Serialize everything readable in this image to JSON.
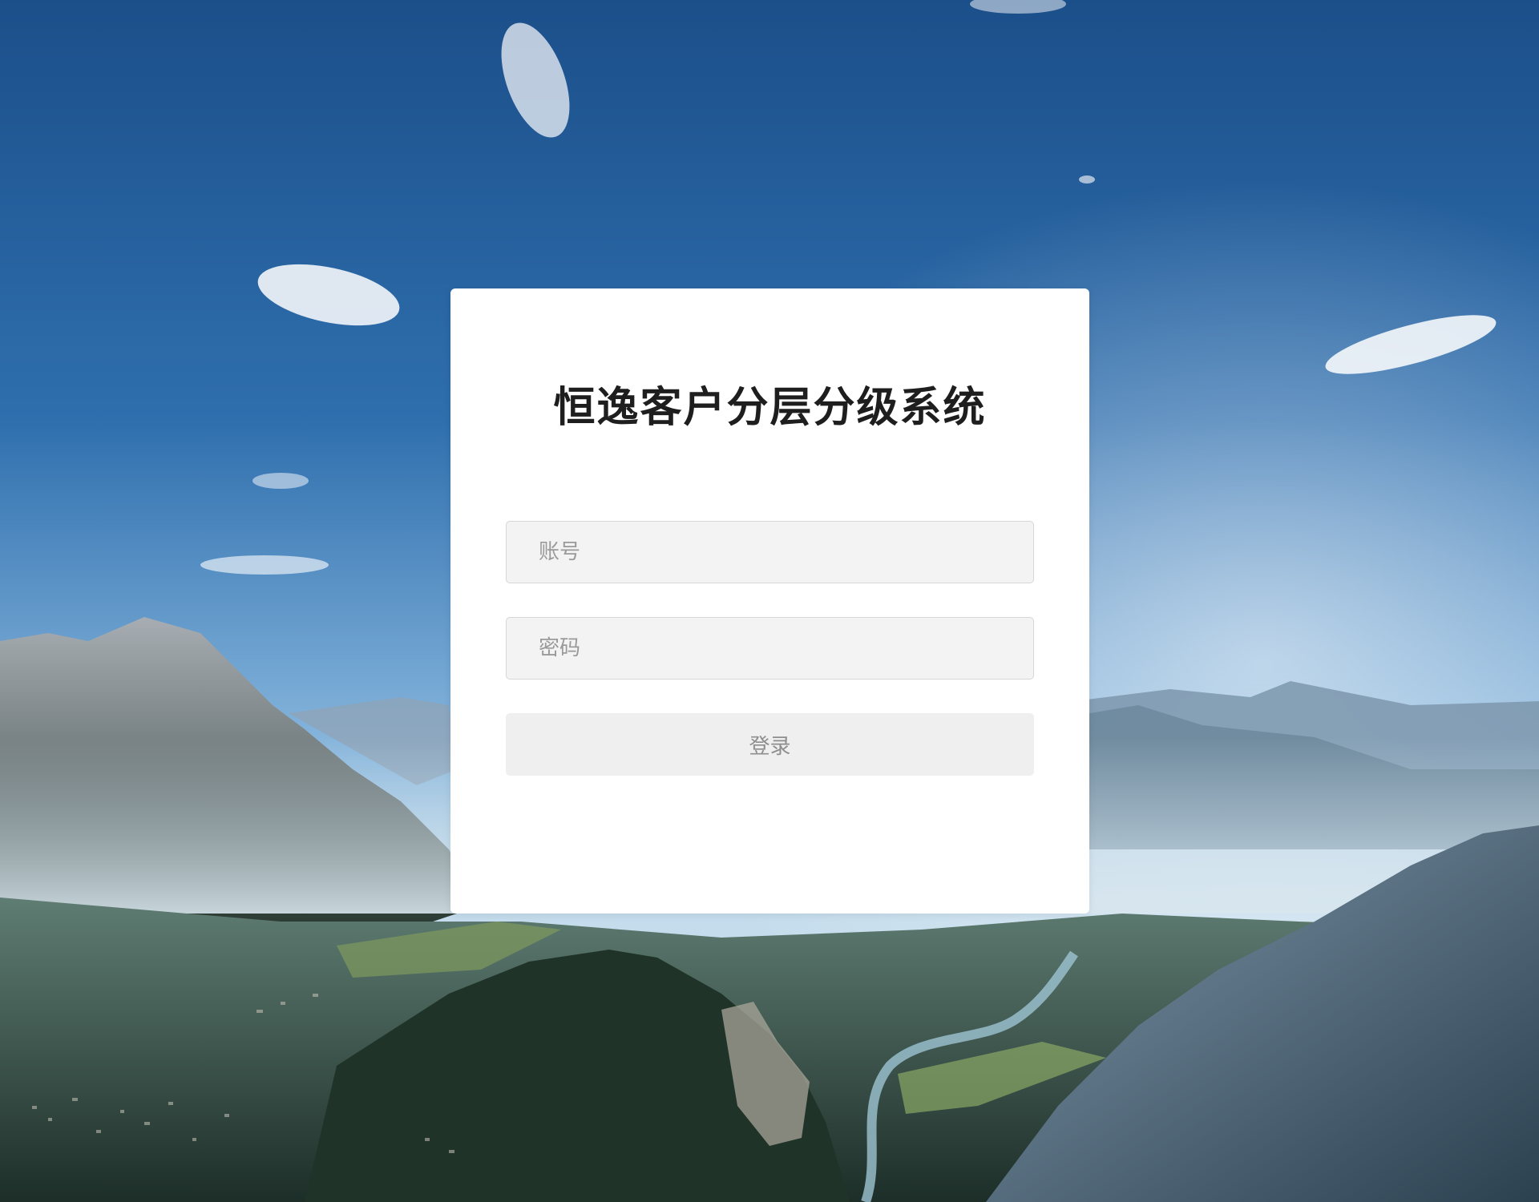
{
  "login": {
    "title": "恒逸客户分层分级系统",
    "account_placeholder": "账号",
    "account_value": "",
    "password_placeholder": "密码",
    "password_value": "",
    "submit_label": "登录"
  },
  "background": {
    "description_icon": "mountain-landscape-photo",
    "sky_top_color": "#1f5d9c",
    "sky_bottom_color": "#a9cbe5"
  }
}
